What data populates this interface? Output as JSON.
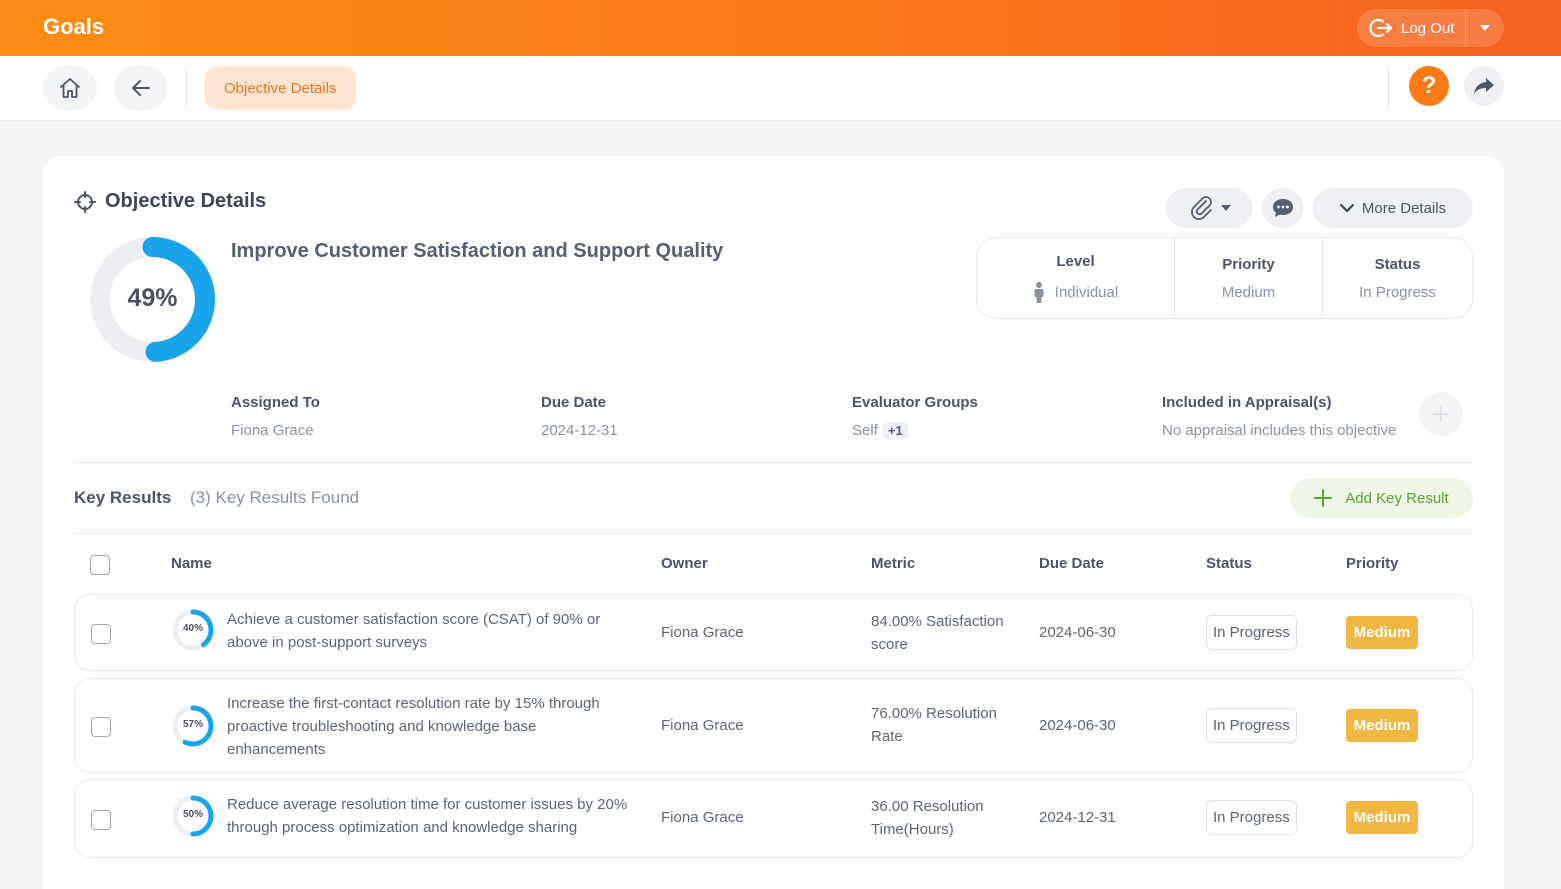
{
  "header": {
    "app_title": "Goals",
    "logout_label": "Log Out"
  },
  "toolbar": {
    "breadcrumb": "Objective Details",
    "help_glyph": "?"
  },
  "objective": {
    "section_title": "Objective Details",
    "progress_percent": 49,
    "progress_label": "49%",
    "title": "Improve Customer Satisfaction and Support Quality",
    "more_details_label": "More Details",
    "level_label": "Level",
    "level_value": "Individual",
    "priority_label": "Priority",
    "priority_value": "Medium",
    "status_label": "Status",
    "status_value": "In Progress",
    "assigned_to_label": "Assigned To",
    "assigned_to_value": "Fiona Grace",
    "due_date_label": "Due Date",
    "due_date_value": "2024-12-31",
    "evaluator_groups_label": "Evaluator Groups",
    "evaluator_groups_value": "Self",
    "evaluator_groups_extra": "+1",
    "appraisal_label": "Included in Appraisal(s)",
    "appraisal_value": "No appraisal includes this objective"
  },
  "key_results": {
    "title": "Key Results",
    "count_text": "(3) Key Results Found",
    "add_label": "Add Key Result",
    "columns": [
      "Name",
      "Owner",
      "Metric",
      "Due Date",
      "Status",
      "Priority"
    ],
    "rows": [
      {
        "progress": 40,
        "progress_label": "40%",
        "name_lines": [
          "Achieve a customer satisfaction score (CSAT) of 90% or",
          "above in post-support surveys"
        ],
        "owner": "Fiona Grace",
        "metric_lines": [
          "84.00% Satisfaction",
          "score"
        ],
        "due_date": "2024-06-30",
        "status": "In Progress",
        "priority": "Medium"
      },
      {
        "progress": 57,
        "progress_label": "57%",
        "name_lines": [
          "Increase the first-contact resolution rate by 15% through",
          "proactive troubleshooting and knowledge base",
          "enhancements"
        ],
        "owner": "Fiona Grace",
        "metric_lines": [
          "76.00% Resolution",
          "Rate"
        ],
        "due_date": "2024-06-30",
        "status": "In Progress",
        "priority": "Medium"
      },
      {
        "progress": 50,
        "progress_label": "50%",
        "name_lines": [
          "Reduce average resolution time for customer issues by 20%",
          "through process optimization and knowledge sharing"
        ],
        "owner": "Fiona Grace",
        "metric_lines": [
          "36.00 Resolution",
          "Time(Hours)"
        ],
        "due_date": "2024-12-31",
        "status": "In Progress",
        "priority": "Medium"
      }
    ]
  },
  "colors": {
    "brand_orange": "#fa7b16",
    "progress_blue": "#1aa4ec",
    "priority_medium": "#f0b842",
    "add_green": "#5aa232"
  },
  "icons": [
    "home-icon",
    "back-arrow-icon",
    "help-icon",
    "share-icon",
    "logout-icon",
    "crosshair-icon",
    "paperclip-icon",
    "comment-icon",
    "chevron-down-icon",
    "person-icon",
    "plus-icon"
  ]
}
